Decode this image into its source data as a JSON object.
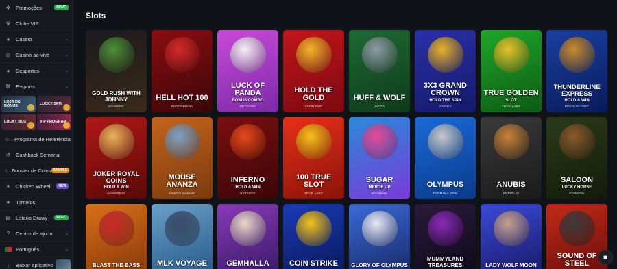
{
  "sidebar": {
    "items_top": [
      {
        "label": "Promoções",
        "icon": "gift-icon",
        "badge": "NOVO"
      },
      {
        "label": "Clube VIP",
        "icon": "crown-icon"
      },
      {
        "label": "Casino",
        "icon": "cards-icon",
        "chevron": true
      },
      {
        "label": "Casino ao vivo",
        "icon": "live-icon",
        "chevron": true
      },
      {
        "label": "Desportos",
        "icon": "ball-icon",
        "chevron": true
      },
      {
        "label": "E-sports",
        "icon": "gamepad-icon",
        "chevron": true
      }
    ],
    "promo_tiles": [
      {
        "label": "LOJA DE BÓNUS"
      },
      {
        "label": "LUCKY SPIN"
      },
      {
        "label": "LUCKY BOX"
      },
      {
        "label": "VIP PROGRAM"
      }
    ],
    "items_bottom": [
      {
        "label": "Programa de Referência",
        "icon": "users-icon"
      },
      {
        "label": "Cashback Semanal",
        "icon": "cashback-icon"
      },
      {
        "label": "Booster de Coins",
        "icon": "rocket-icon",
        "badge": "SAMPLE"
      },
      {
        "label": "Chicken Wheel",
        "icon": "wheel-icon",
        "badge": "NEW"
      },
      {
        "label": "Torneios",
        "icon": "trophy-icon"
      },
      {
        "label": "Lotaria Drawy",
        "icon": "ticket-icon",
        "badge": "NOVO"
      },
      {
        "label": "Centro de ajuda",
        "icon": "help-icon",
        "chevron": true
      },
      {
        "label": "Português",
        "icon": "flag-pt-icon",
        "chevron": true
      },
      {
        "label": "Baixar aplicativo",
        "icon": "download-icon"
      }
    ]
  },
  "main": {
    "title": "Slots"
  },
  "games": [
    {
      "title": "GOLD RUSH WITH JOHNNY",
      "sub": "",
      "provider": "BGAMING",
      "bg": [
        "#1b1a1f",
        "#3a2a1a"
      ],
      "art": "#4f8f3a",
      "size": "sm"
    },
    {
      "title": "HELL HOT 100",
      "sub": "",
      "provider": "ENDORPHINA",
      "bg": [
        "#8a0d12",
        "#3a0608"
      ],
      "art": "#d42a2a",
      "size": ""
    },
    {
      "title": "LUCK OF PANDA",
      "sub": "BONUS COMBO",
      "provider": "NETGAME",
      "bg": [
        "#c94ad8",
        "#7a2aa8"
      ],
      "art": "#f2f2f2",
      "size": ""
    },
    {
      "title": "HOLD THE GOLD",
      "sub": "",
      "provider": "1SPIN4WIN",
      "bg": [
        "#c4141c",
        "#7a0a10"
      ],
      "art": "#f2b52a",
      "size": ""
    },
    {
      "title": "HUFF & WOLF",
      "sub": "",
      "provider": "JACKS",
      "bg": [
        "#1f6a33",
        "#0e3a1c"
      ],
      "art": "#8f9aa5",
      "size": ""
    },
    {
      "title": "3X3 GRAND CROWN",
      "sub": "HOLD THE SPIN",
      "provider": "GAMZIX",
      "bg": [
        "#2a2fa8",
        "#141a6a"
      ],
      "art": "#e8b22a",
      "size": ""
    },
    {
      "title": "TRUE GOLDEN",
      "sub": "SLOT",
      "provider": "TRUE LABS",
      "bg": [
        "#1ea52a",
        "#0e5a14"
      ],
      "art": "#e8c02a",
      "size": ""
    },
    {
      "title": "THUNDERLINE EXPRESS",
      "sub": "HOLD & WIN",
      "provider": "PENGUIN KING",
      "bg": [
        "#1a3fa0",
        "#0a1a5a"
      ],
      "art": "#c98a2a",
      "size": "md"
    },
    {
      "title": "JOKER ROYAL COINS",
      "sub": "HOLD & WIN",
      "provider": "GAMEBEAT",
      "bg": [
        "#b01818",
        "#5a0808"
      ],
      "art": "#e8b45a",
      "size": "md"
    },
    {
      "title": "MOUSE ANANZA",
      "sub": "",
      "provider": "7RINGS GAMING",
      "bg": [
        "#c4641c",
        "#7a3a0e"
      ],
      "art": "#7aa0c8",
      "size": ""
    },
    {
      "title": "INFERNO",
      "sub": "HOLD & WIN",
      "provider": "BETSOFT",
      "bg": [
        "#7a0e10",
        "#3a0608"
      ],
      "art": "#e84a1a",
      "size": ""
    },
    {
      "title": "100 TRUE SLOT",
      "sub": "",
      "provider": "TRUE LABS",
      "bg": [
        "#e8301a",
        "#8a1208"
      ],
      "art": "#f2c21a",
      "size": ""
    },
    {
      "title": "SUGAR",
      "sub": "MERGE UP",
      "provider": "BGAMING",
      "bg": [
        "#2a8ad8",
        "#7a3ad8"
      ],
      "art": "#e84a9a",
      "size": ""
    },
    {
      "title": "OLYMPUS",
      "sub": "",
      "provider": "FORMULA SPIN",
      "bg": [
        "#1a6ad8",
        "#0a3a8a"
      ],
      "art": "#c8c8c8",
      "size": ""
    },
    {
      "title": "ANUBIS",
      "sub": "",
      "provider": "POPIPLAY",
      "bg": [
        "#3a3a3a",
        "#1a1a1a"
      ],
      "art": "#c8823a",
      "size": ""
    },
    {
      "title": "SALOON",
      "sub": "LUCKY HORSE",
      "provider": "PIXMOVE",
      "bg": [
        "#2a3a1a",
        "#141a0a"
      ],
      "art": "#8a5a2a",
      "size": ""
    },
    {
      "title": "BLAST THE BASS",
      "sub": "",
      "provider": "",
      "bg": [
        "#d8701a",
        "#8a3a0a"
      ],
      "art": "#c8282a",
      "size": "sm"
    },
    {
      "title": "MLK VOYAGE",
      "sub": "",
      "provider": "",
      "bg": [
        "#6aa0c8",
        "#2a5a8a"
      ],
      "art": "#3a4a6a",
      "size": ""
    },
    {
      "title": "GEMHALLA",
      "sub": "",
      "provider": "",
      "bg": [
        "#8a3ab8",
        "#3a1a6a"
      ],
      "art": "#e8d8c8",
      "size": ""
    },
    {
      "title": "COIN STRIKE",
      "sub": "",
      "provider": "",
      "bg": [
        "#1a3ab8",
        "#0a1a5a"
      ],
      "art": "#f2c21a",
      "size": ""
    },
    {
      "title": "GLORY OF OLYMPUS",
      "sub": "",
      "provider": "",
      "bg": [
        "#3a6ad8",
        "#1a2a6a"
      ],
      "art": "#e8e8f2",
      "size": "sm"
    },
    {
      "title": "MUMMYLAND TREASURES",
      "sub": "",
      "provider": "",
      "bg": [
        "#2a1a3a",
        "#0e0a1a"
      ],
      "art": "#8a2ab8",
      "size": "sm"
    },
    {
      "title": "LADY WOLF MOON",
      "sub": "",
      "provider": "",
      "bg": [
        "#3a4ad8",
        "#1a1a6a"
      ],
      "art": "#c8a08a",
      "size": "sm"
    },
    {
      "title": "SOUND OF STEEL",
      "sub": "",
      "provider": "",
      "bg": [
        "#c42a1a",
        "#6a0e0a"
      ],
      "art": "#3a3a3a",
      "size": ""
    }
  ]
}
